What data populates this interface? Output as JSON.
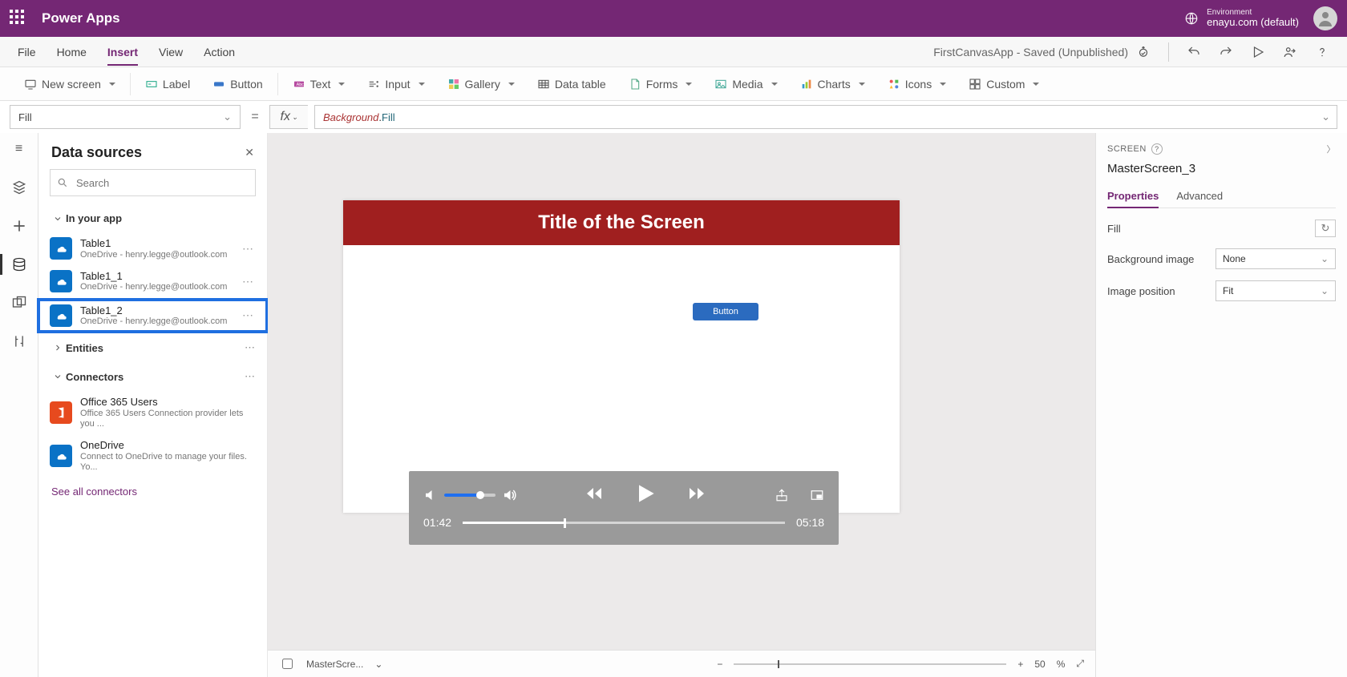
{
  "header": {
    "brand": "Power Apps",
    "env_label": "Environment",
    "env_value": "enayu.com (default)"
  },
  "menubar": {
    "items": [
      "File",
      "Home",
      "Insert",
      "View",
      "Action"
    ],
    "active_index": 2,
    "app_status": "FirstCanvasApp - Saved (Unpublished)"
  },
  "ribbon": {
    "new_screen": "New screen",
    "label": "Label",
    "button": "Button",
    "text": "Text",
    "input": "Input",
    "gallery": "Gallery",
    "data_table": "Data table",
    "forms": "Forms",
    "media": "Media",
    "charts": "Charts",
    "icons": "Icons",
    "custom": "Custom"
  },
  "fx": {
    "property": "Fill",
    "formula_bg": "Background",
    "formula_dot": ".",
    "formula_prop": "Fill"
  },
  "panel": {
    "title": "Data sources",
    "search_placeholder": "Search",
    "in_your_app": "In your app",
    "entities": "Entities",
    "connectors": "Connectors",
    "see_all": "See all connectors",
    "items": [
      {
        "name": "Table1",
        "sub": "OneDrive - henry.legge@outlook.com"
      },
      {
        "name": "Table1_1",
        "sub": "OneDrive - henry.legge@outlook.com"
      },
      {
        "name": "Table1_2",
        "sub": "OneDrive - henry.legge@outlook.com"
      }
    ],
    "connectors_list": [
      {
        "name": "Office 365 Users",
        "sub": "Office 365 Users Connection provider lets you ..."
      },
      {
        "name": "OneDrive",
        "sub": "Connect to OneDrive to manage your files. Yo..."
      }
    ],
    "highlight_index": 2
  },
  "canvas": {
    "title": "Title of the Screen",
    "button": "Button"
  },
  "player": {
    "current": "01:42",
    "total": "05:18"
  },
  "props": {
    "scope": "SCREEN",
    "name": "MasterScreen_3",
    "tabs": [
      "Properties",
      "Advanced"
    ],
    "active_tab": 0,
    "fill_label": "Fill",
    "bgimg_label": "Background image",
    "bgimg_value": "None",
    "imgpos_label": "Image position",
    "imgpos_value": "Fit"
  },
  "status": {
    "screen_name": "MasterScre...",
    "zoom_percent": "50",
    "zoom_unit": "%"
  }
}
